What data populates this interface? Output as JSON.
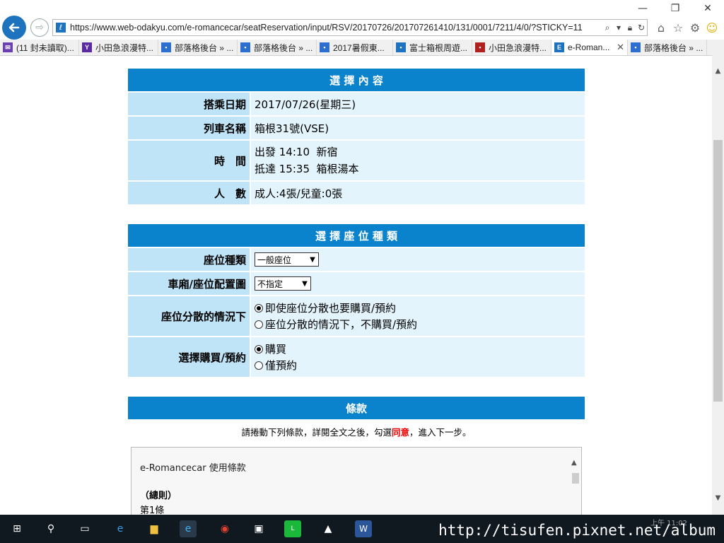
{
  "browser": {
    "url": "https://www.web-odakyu.com/e-romancecar/seatReservation/input/RSV/20170726/201707261410/131/0001/7211/4/0/?STICKY=11",
    "tabs": [
      {
        "label": "(11 封未讀取)...",
        "color": "#6a3fb0",
        "icon_glyph": "✉"
      },
      {
        "label": "小田急浪漫特...",
        "color": "#5a2aa0",
        "icon_glyph": "Y"
      },
      {
        "label": "部落格後台 » ...",
        "color": "#2d6fd0",
        "icon_glyph": "▪"
      },
      {
        "label": "部落格後台 » ...",
        "color": "#2d6fd0",
        "icon_glyph": "▪"
      },
      {
        "label": "2017暑假東...",
        "color": "#2d6fd0",
        "icon_glyph": "▪"
      },
      {
        "label": "富士箱根周遊...",
        "color": "#1e73be",
        "icon_glyph": "▪"
      },
      {
        "label": "小田急浪漫特...",
        "color": "#b0201e",
        "icon_glyph": "▪"
      },
      {
        "label": "e-Roman...",
        "color": "#1e73be",
        "icon_glyph": "E"
      },
      {
        "label": "部落格後台 » ...",
        "color": "#2d6fd0",
        "icon_glyph": "▪"
      }
    ],
    "active_tab_index": 7
  },
  "selection": {
    "header": "選 擇 內 容",
    "rows": {
      "date_label": "搭乘日期",
      "date_value": "2017/07/26(星期三)",
      "train_label": "列車名稱",
      "train_value": "箱根31號(VSE)",
      "time_label": "時　間",
      "depart": "出發 14:10  新宿",
      "arrive": "抵達 15:35  箱根湯本",
      "people_label": "人　數",
      "people_value": "成人:4張/兒童:0張"
    }
  },
  "seat": {
    "header": "選 擇 座 位 種 類",
    "type_label": "座位種類",
    "type_selected": "一般座位",
    "car_label": "車廂/座位配置圖",
    "car_selected": "不指定",
    "scatter_label": "座位分散的情況下",
    "scatter_opt1": "即使座位分散也要購買/預約",
    "scatter_opt2": "座位分散的情況下，不購買/預約",
    "purchase_label": "選擇購買/預約",
    "purchase_opt1": "購買",
    "purchase_opt2": "僅預約"
  },
  "terms": {
    "header": "條款",
    "note_before": "請捲動下列條款，詳閱全文之後，勾選",
    "note_agree": "同意",
    "note_after": "，進入下一步。",
    "box_title": "e-Romancecar 使用條款",
    "general": "（總則）",
    "article1": "第1條"
  },
  "taskbar": {
    "watermark": "http://tisufen.pixnet.net/album",
    "clock": "上午 11:02"
  }
}
